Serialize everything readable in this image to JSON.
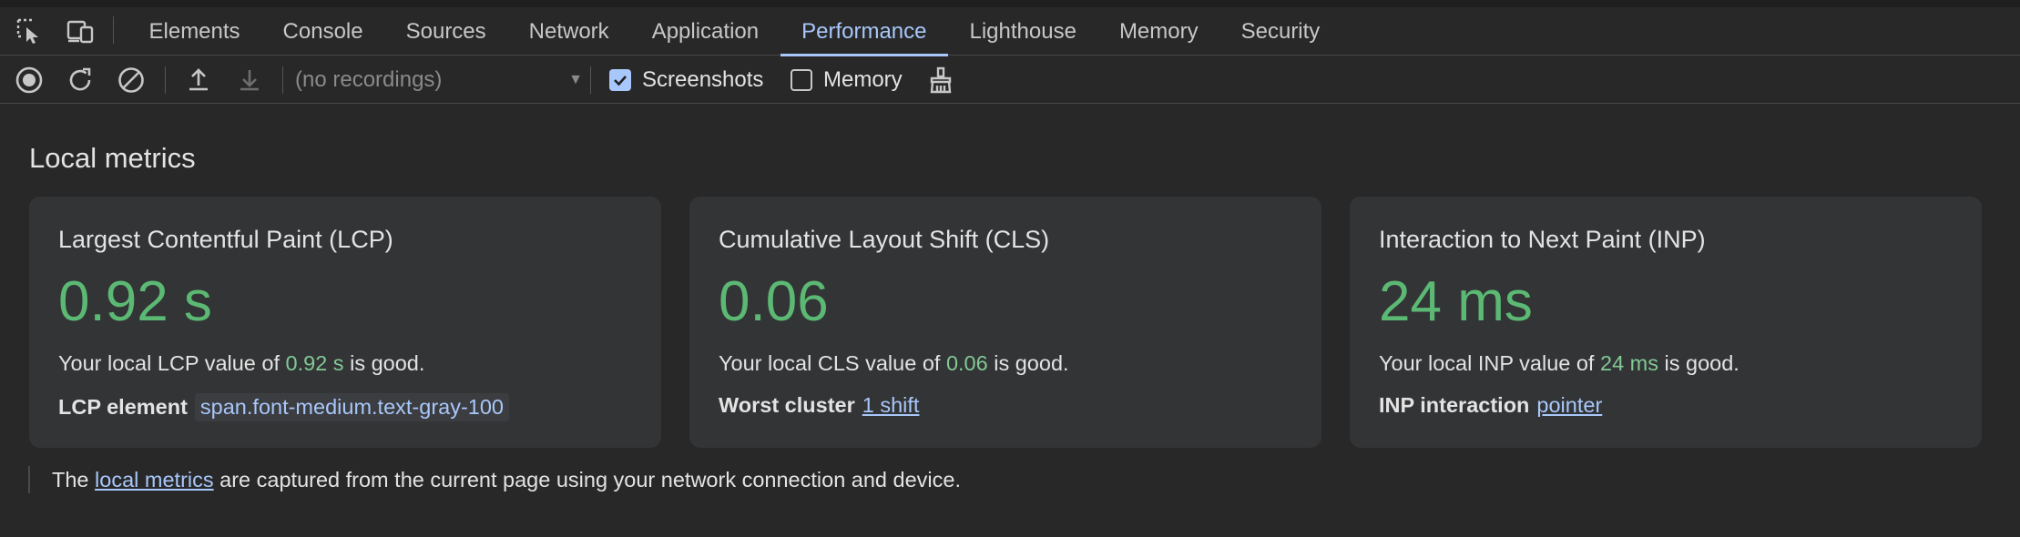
{
  "devtools": {
    "tabs": [
      {
        "label": "Elements"
      },
      {
        "label": "Console"
      },
      {
        "label": "Sources"
      },
      {
        "label": "Network"
      },
      {
        "label": "Application"
      },
      {
        "label": "Performance",
        "active": true
      },
      {
        "label": "Lighthouse"
      },
      {
        "label": "Memory"
      },
      {
        "label": "Security"
      }
    ],
    "accent_color": "#a8c7fa"
  },
  "toolbar": {
    "recording_select": "(no recordings)",
    "screenshots_label": "Screenshots",
    "screenshots_checked": true,
    "memory_label": "Memory",
    "memory_checked": false
  },
  "local_metrics": {
    "title": "Local metrics",
    "good_color": "#5bb974",
    "cards": [
      {
        "title": "Largest Contentful Paint (LCP)",
        "value": "0.92 s",
        "desc_prefix": "Your local LCP value of ",
        "desc_value": "0.92 s",
        "desc_suffix": " is good.",
        "detail_label": "LCP element",
        "detail_value": "span.font-medium.text-gray-100"
      },
      {
        "title": "Cumulative Layout Shift (CLS)",
        "value": "0.06",
        "desc_prefix": "Your local CLS value of ",
        "desc_value": "0.06",
        "desc_suffix": " is good.",
        "detail_label": "Worst cluster",
        "detail_value": "1 shift"
      },
      {
        "title": "Interaction to Next Paint (INP)",
        "value": "24 ms",
        "desc_prefix": "Your local INP value of ",
        "desc_value": "24 ms",
        "desc_suffix": " is good.",
        "detail_label": "INP interaction",
        "detail_value": "pointer"
      }
    ],
    "footnote_prefix": "The ",
    "footnote_link": "local metrics",
    "footnote_suffix": " are captured from the current page using your network connection and device."
  }
}
